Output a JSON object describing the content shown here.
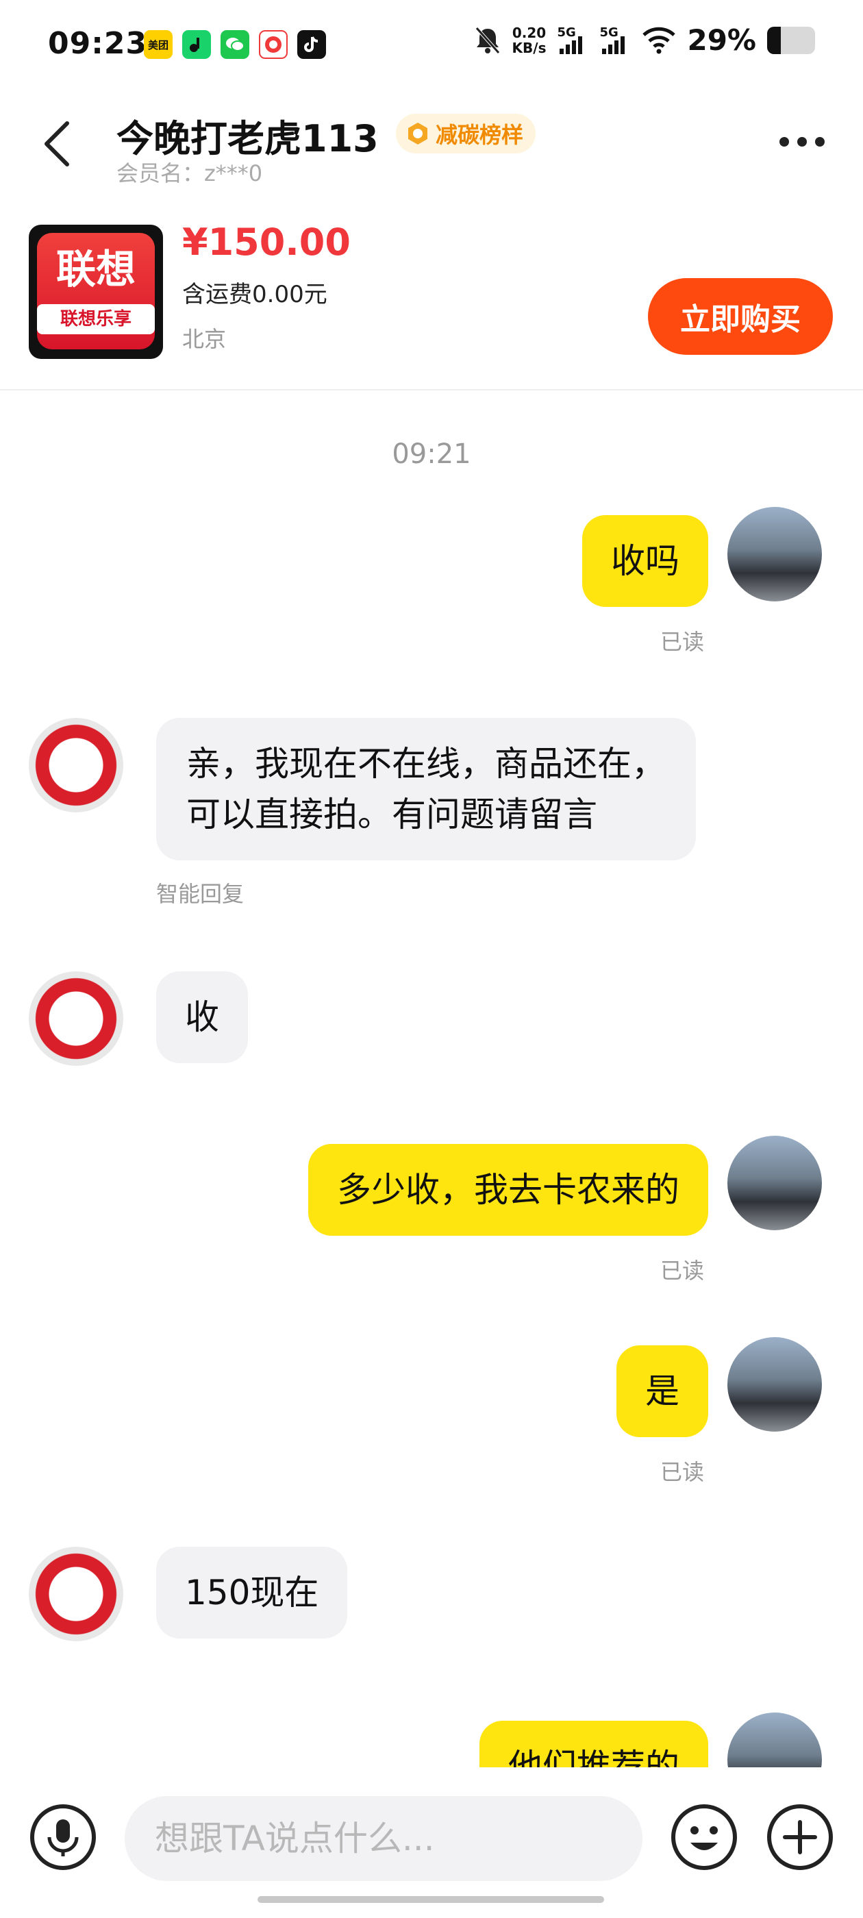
{
  "status_bar": {
    "time": "09:23",
    "apps": [
      {
        "name": "meituan-icon",
        "text": "美团",
        "color": "#ffd000"
      },
      {
        "name": "music-app-icon",
        "text": "",
        "color": "#19d36a"
      },
      {
        "name": "wechat-icon",
        "text": "",
        "color": "#1ec84e"
      },
      {
        "name": "game-app-icon",
        "text": "",
        "color": "#f03a3a"
      },
      {
        "name": "tiktok-icon",
        "text": "",
        "color": "#111111"
      }
    ],
    "speed_value": "0.20",
    "speed_unit": "KB/s",
    "net1": "5G",
    "net2": "5G",
    "battery": "29%",
    "battery_level": 0.29
  },
  "header": {
    "title": "今晚打老虎113",
    "badge": "减碳榜样",
    "member": "会员名：z***0"
  },
  "product": {
    "brand_text": "联想",
    "brand_strip": "联想乐享",
    "price": "¥150.00",
    "shipping": "含运费0.00元",
    "location": "北京",
    "buy_label": "立即购买"
  },
  "chat": {
    "timestamp": "09:21",
    "read_label": "已读",
    "auto_reply_label": "智能回复",
    "messages": [
      {
        "side": "me",
        "text": "收吗"
      },
      {
        "side": "them",
        "text": "亲，我现在不在线，商品还在，\n可以直接拍。有问题请留言"
      },
      {
        "side": "them",
        "text": "收"
      },
      {
        "side": "me",
        "text": "多少收，我去卡农来的"
      },
      {
        "side": "me",
        "text": "是"
      },
      {
        "side": "them",
        "text": "150现在"
      },
      {
        "side": "me",
        "text": "他们推荐的"
      }
    ]
  },
  "input": {
    "placeholder": "想跟TA说点什么..."
  }
}
